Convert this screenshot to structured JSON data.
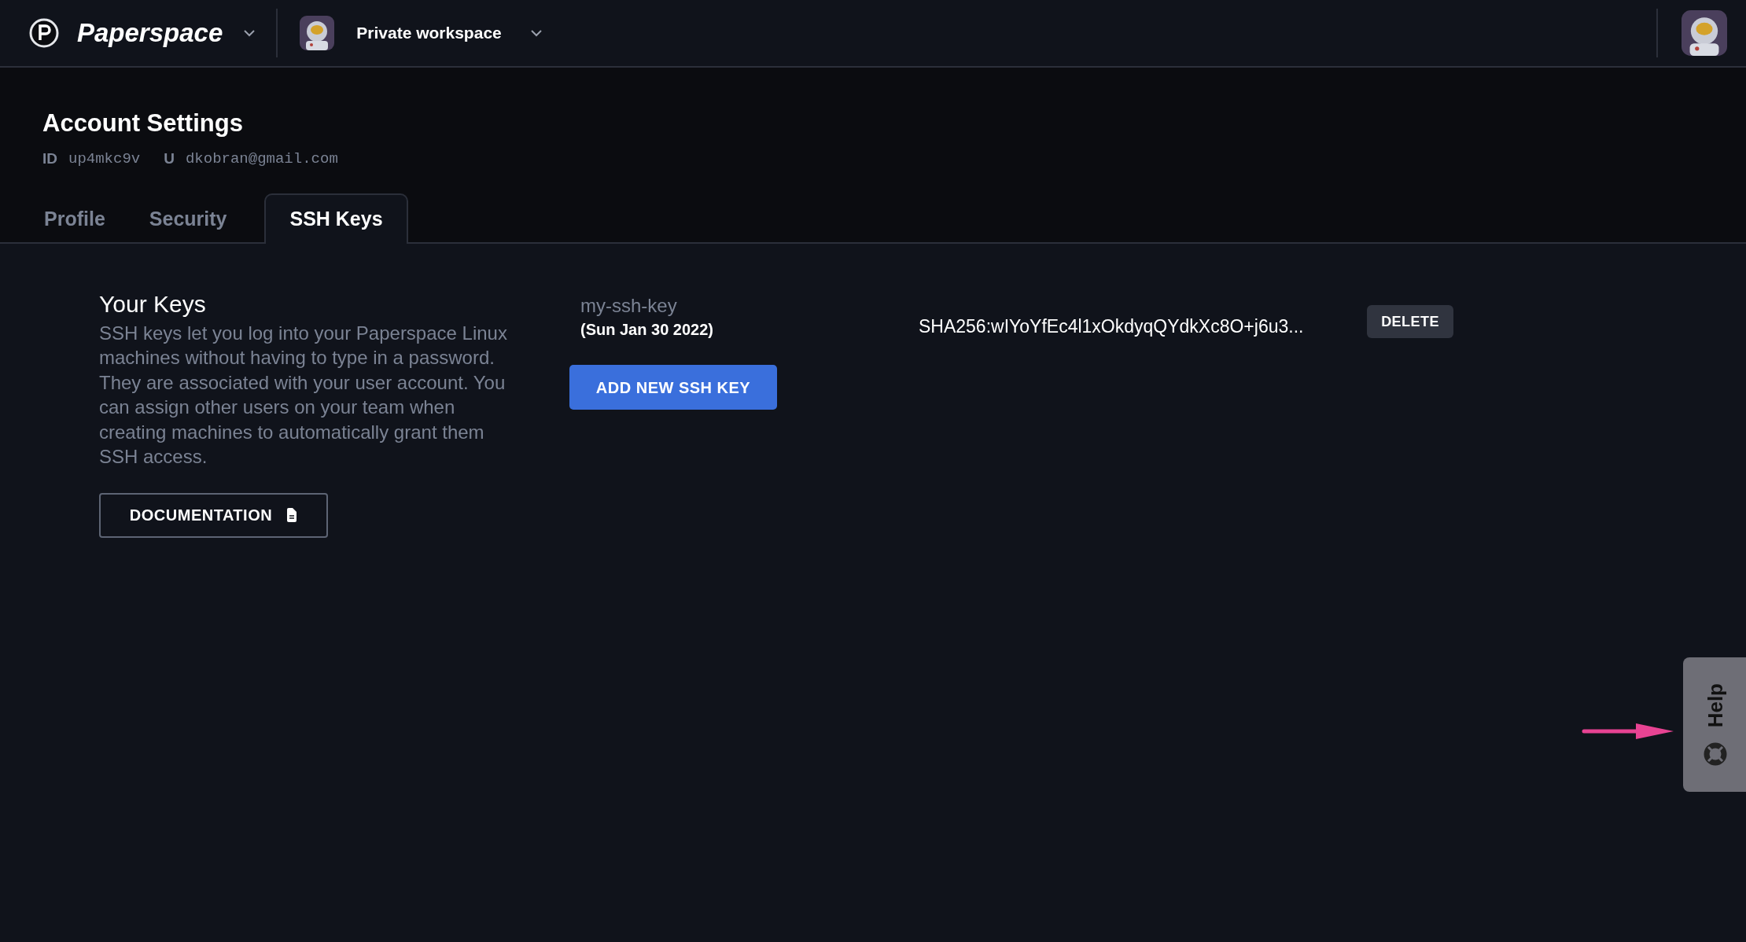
{
  "header": {
    "brand": "Paperspace",
    "workspace": "Private workspace"
  },
  "account": {
    "title": "Account Settings",
    "id_label": "ID",
    "id": "up4mkc9v",
    "user_label": "U",
    "email": "dkobran@gmail.com"
  },
  "tabs": [
    {
      "label": "Profile",
      "selected": false
    },
    {
      "label": "Security",
      "selected": false
    },
    {
      "label": "SSH Keys",
      "selected": true
    }
  ],
  "section": {
    "title": "Your Keys",
    "description": "SSH keys let you log into your Paperspace Linux machines without having to type in a password. They are associated with your user account. You can assign other users on your team when creating machines to automatically grant them SSH access.",
    "documentation_button": "DOCUMENTATION"
  },
  "keys": [
    {
      "name": "my-ssh-key",
      "date": "(Sun Jan 30 2022)",
      "fingerprint": "SHA256:wIYoYfEc4l1xOkdyqQYdkXc8O+j6u3...",
      "delete_button": "DELETE"
    }
  ],
  "add_button": "ADD NEW SSH KEY",
  "help": {
    "label": "Help"
  }
}
